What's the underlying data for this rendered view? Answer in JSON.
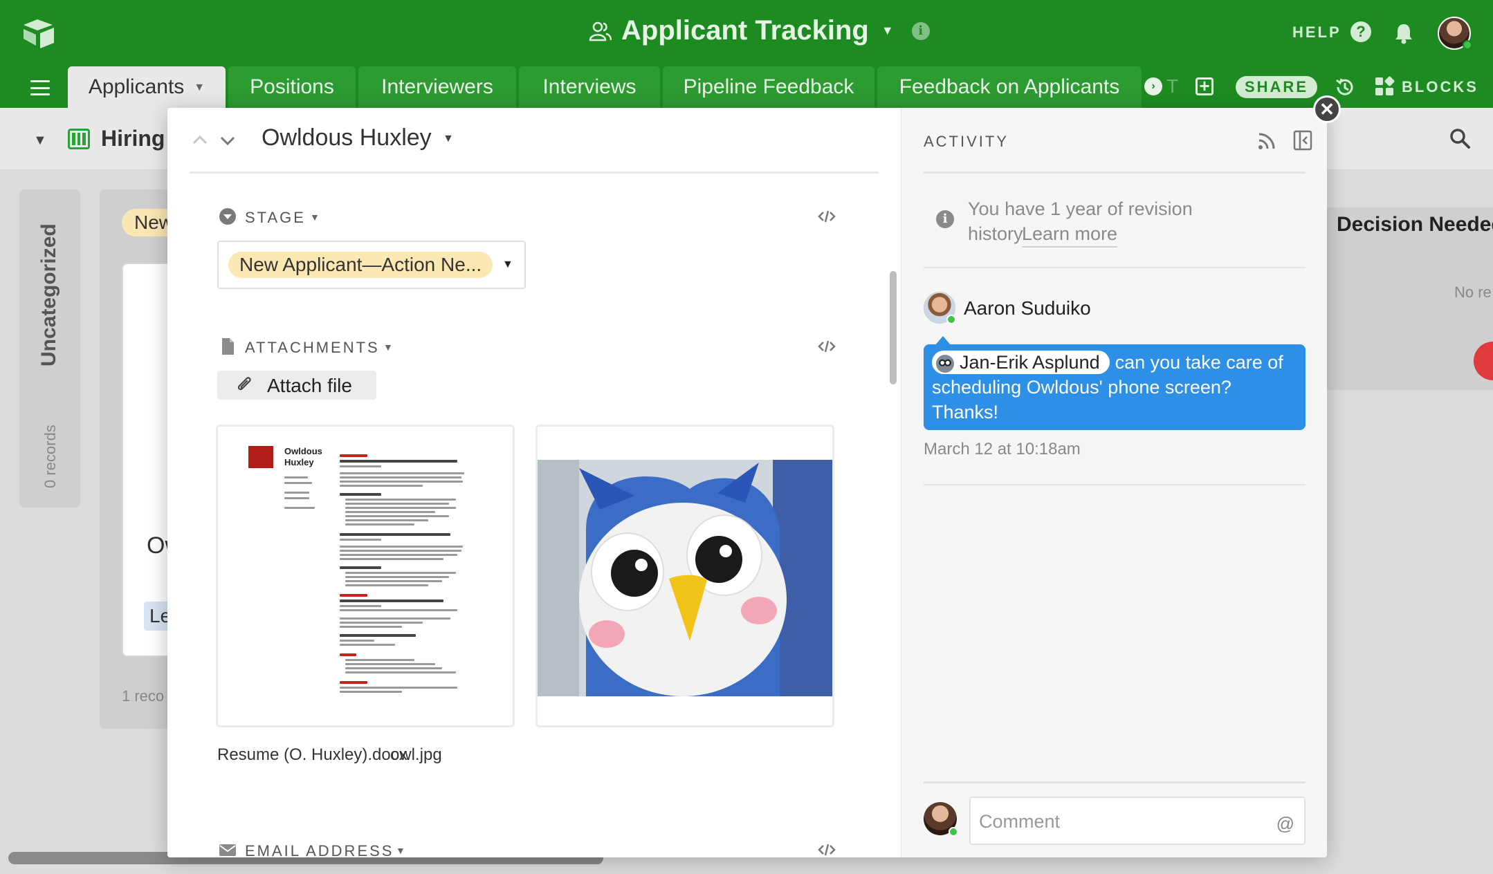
{
  "app": {
    "base_title": "Applicant Tracking",
    "help_label": "HELP",
    "help_glyph": "?",
    "info_glyph": "i"
  },
  "tabs": [
    {
      "label": "Applicants",
      "active": true
    },
    {
      "label": "Positions"
    },
    {
      "label": "Interviewers"
    },
    {
      "label": "Interviews"
    },
    {
      "label": "Pipeline Feedback"
    },
    {
      "label": "Feedback on Applicants"
    }
  ],
  "tab_more_label": "T",
  "toolbar": {
    "share_label": "SHARE",
    "blocks_label": "BLOCKS"
  },
  "view": {
    "name": "Hiring"
  },
  "board": {
    "uncategorized_title": "Uncategorized",
    "uncategorized_count": "0 records",
    "new_stage_pill": "New",
    "card_title": "Ow",
    "card_pill": "Le",
    "new_stage_footer": "1 reco",
    "decision_title": "Decision Needed",
    "decision_empty": "No re"
  },
  "record": {
    "title": "Owldous Huxley",
    "stage_label": "STAGE",
    "stage_value": "New Applicant—Action Ne...",
    "attachments_label": "ATTACHMENTS",
    "attach_button": "Attach file",
    "attachments": [
      {
        "name": "Resume (O. Huxley).docx"
      },
      {
        "name": "owl.jpg"
      }
    ],
    "resume_name_line1": "Owldous",
    "resume_name_line2": "Huxley",
    "email_label": "EMAIL ADDRESS"
  },
  "activity": {
    "title": "ACTIVITY",
    "revision_text": "You have 1 year of revision history.",
    "revision_link": "Learn more",
    "comment_author": "Aaron Suduiko",
    "mention": "Jan-Erik Asplund",
    "comment_text": "can you take care of scheduling Owldous' phone screen? Thanks!",
    "comment_time": "March 12 at 10:18am",
    "comment_placeholder": "Comment",
    "comment_at": "@"
  },
  "colors": {
    "header_green": "#1d8b22",
    "tab_green": "#2c9b31",
    "stage_yellow": "#fce8b2",
    "bubble_blue": "#2d8fe6",
    "online_green": "#3fc34a"
  },
  "icons": [
    "airtable-logo-icon",
    "people-icon",
    "info-icon",
    "help-icon",
    "bell-icon",
    "hamburger-icon",
    "chevron-right-circle-icon",
    "plus-icon",
    "history-icon",
    "blocks-icon",
    "kanban-icon",
    "search-icon",
    "chevron-up-icon",
    "chevron-down-icon",
    "single-select-icon",
    "file-icon",
    "code-icon",
    "paperclip-icon",
    "envelope-icon",
    "rss-icon",
    "collapse-panel-icon",
    "close-icon"
  ]
}
